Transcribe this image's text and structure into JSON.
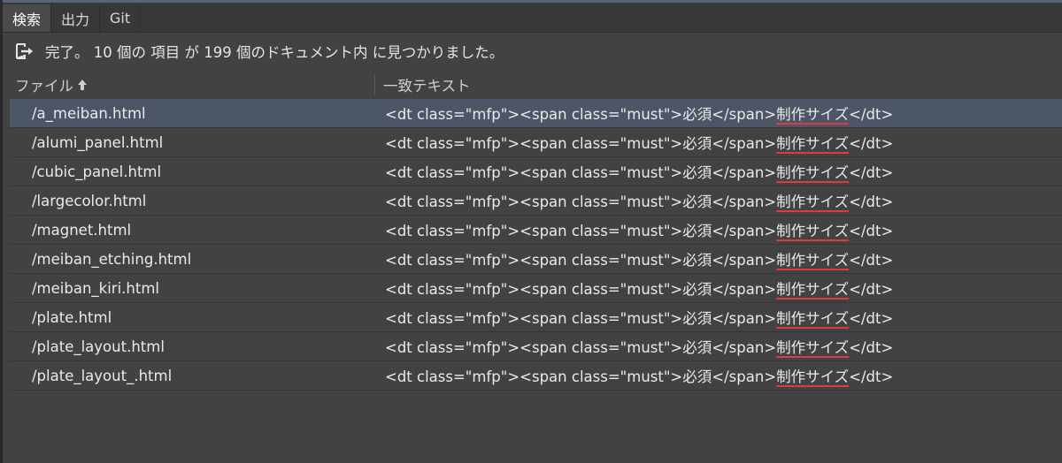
{
  "tabs": [
    {
      "label": "検索",
      "active": true
    },
    {
      "label": "出力",
      "active": false
    },
    {
      "label": "Git",
      "active": false
    }
  ],
  "status": {
    "icon": "exit-icon",
    "text": "完了。 10 個の 項目 が 199 個のドキュメント内 に見つかりました。"
  },
  "columns": {
    "file": "ファイル",
    "sort_icon": "sort-ascending-icon",
    "match": "一致テキスト"
  },
  "results": [
    {
      "file": "/a_meiban.html",
      "before": "<dt class=\"mfp\"><span class=\"must\">必須</span>",
      "match": "制作サイズ",
      "after": "</dt>"
    },
    {
      "file": "/alumi_panel.html",
      "before": "<dt class=\"mfp\"><span class=\"must\">必須</span>",
      "match": "制作サイズ",
      "after": "</dt>"
    },
    {
      "file": "/cubic_panel.html",
      "before": "<dt class=\"mfp\"><span class=\"must\">必須</span>",
      "match": "制作サイズ",
      "after": "</dt>"
    },
    {
      "file": "/largecolor.html",
      "before": "<dt class=\"mfp\"><span class=\"must\">必須</span>",
      "match": "制作サイズ",
      "after": "</dt>"
    },
    {
      "file": "/magnet.html",
      "before": "<dt class=\"mfp\"><span class=\"must\">必須</span>",
      "match": "制作サイズ",
      "after": "</dt>"
    },
    {
      "file": "/meiban_etching.html",
      "before": "<dt class=\"mfp\"><span class=\"must\">必須</span>",
      "match": "制作サイズ",
      "after": "</dt>"
    },
    {
      "file": "/meiban_kiri.html",
      "before": "<dt class=\"mfp\"><span class=\"must\">必須</span>",
      "match": "制作サイズ",
      "after": "</dt>"
    },
    {
      "file": "/plate.html",
      "before": "<dt class=\"mfp\"><span class=\"must\">必須</span>",
      "match": "制作サイズ",
      "after": "</dt>"
    },
    {
      "file": "/plate_layout.html",
      "before": "<dt class=\"mfp\"><span class=\"must\">必須</span>",
      "match": "制作サイズ",
      "after": "</dt>"
    },
    {
      "file": "/plate_layout_.html",
      "before": "<dt class=\"mfp\"><span class=\"must\">必須</span>",
      "match": "制作サイズ",
      "after": "</dt>"
    }
  ],
  "colors": {
    "panel_bg": "#424242",
    "selected_row": "#4d5666",
    "match_underline": "#e03a3a"
  }
}
